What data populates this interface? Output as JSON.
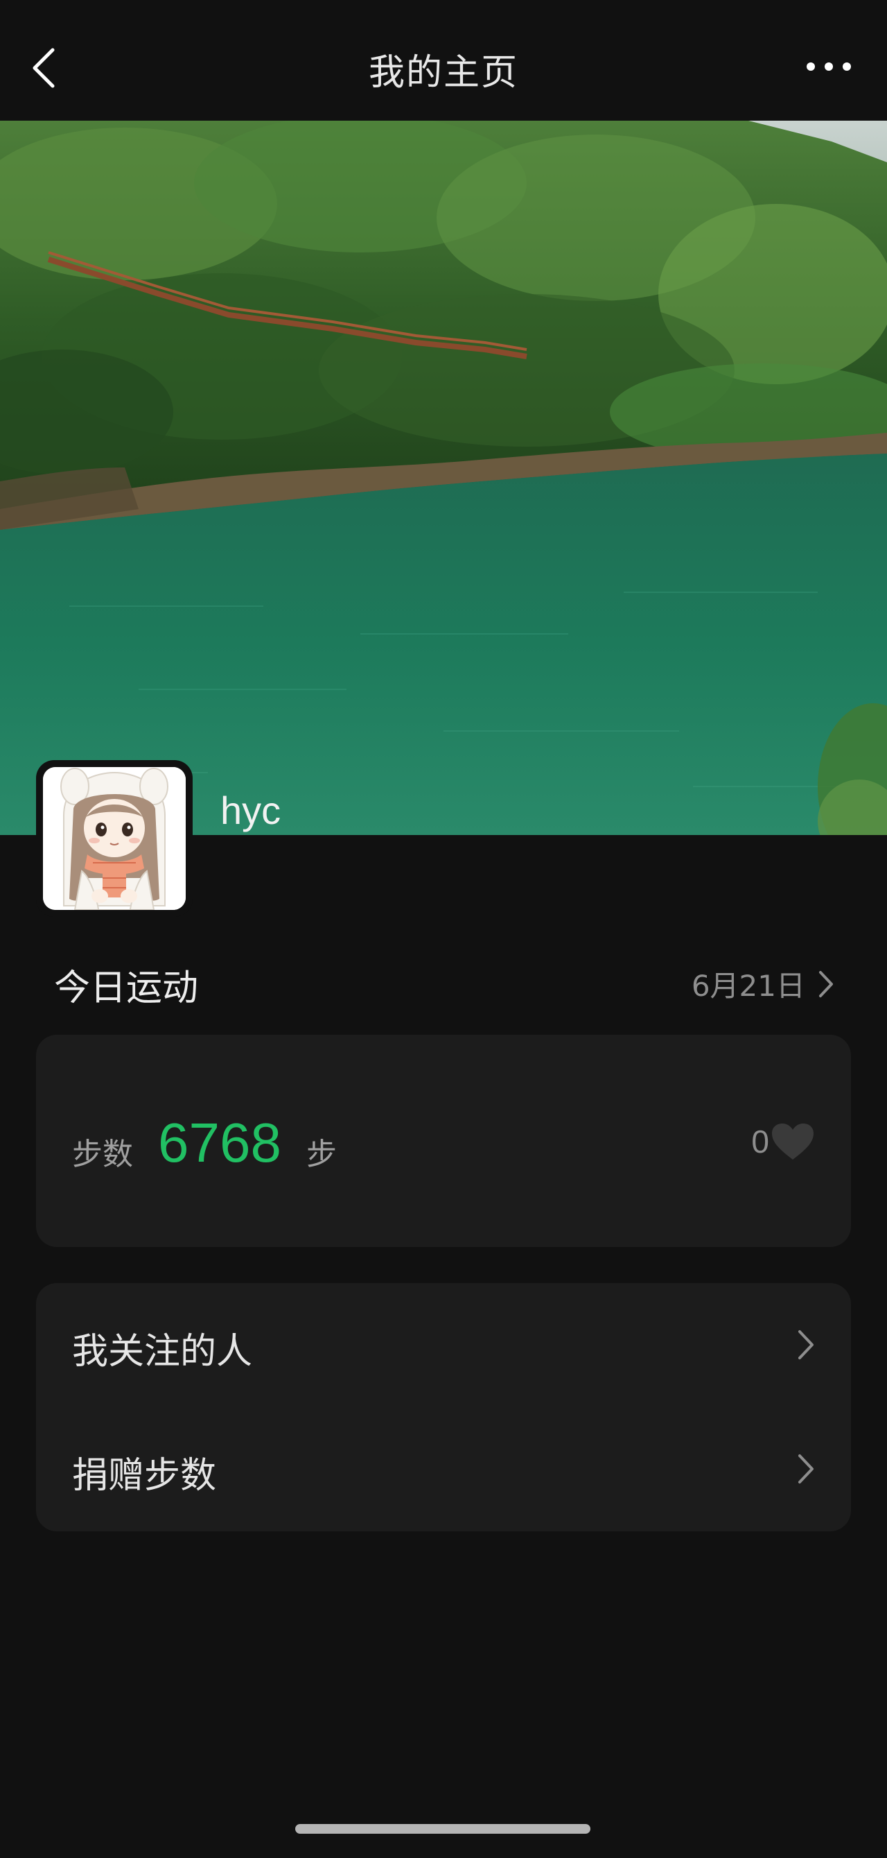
{
  "navbar": {
    "title": "我的主页"
  },
  "profile": {
    "username": "hyc"
  },
  "today": {
    "section_title": "今日运动",
    "date": "6月21日"
  },
  "steps": {
    "label": "步数",
    "value": "6768",
    "unit": "步",
    "likes": "0"
  },
  "menu": {
    "items": [
      {
        "label": "我关注的人"
      },
      {
        "label": "捐赠步数"
      }
    ]
  },
  "colors": {
    "accent": "#21c063",
    "background": "#111111",
    "card": "#1c1c1c"
  },
  "icons": [
    "back-arrow-icon",
    "more-dots-icon",
    "chevron-right-icon",
    "heart-icon"
  ]
}
